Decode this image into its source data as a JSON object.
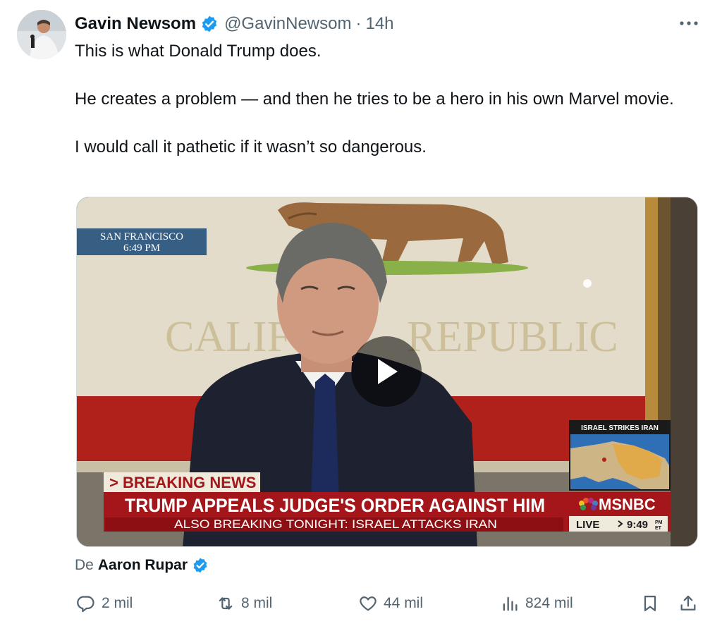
{
  "author": {
    "name": "Gavin Newsom",
    "handle": "@GavinNewsom",
    "separator": "·",
    "time": "14h"
  },
  "tweet": {
    "line1": "This is what Donald Trump does.",
    "line2": "He creates a problem — and then he tries to be a hero in his own Marvel movie.",
    "line3": "I would call it pathetic if it wasn’t so dangerous."
  },
  "video": {
    "location": "SAN FRANCISCO",
    "clock": "6:49 PM",
    "flag_text_left": "CALIFO",
    "flag_text_right": "REPUBLIC",
    "breaking_tag": "> BREAKING NEWS",
    "headline": "TRUMP APPEALS JUDGE'S ORDER AGAINST HIM",
    "subheadline": "ALSO BREAKING TONIGHT: ISRAEL ATTACKS IRAN",
    "inset_title": "ISRAEL STRIKES IRAN",
    "network": "MSNBC",
    "live": "LIVE",
    "live_time": "9:49",
    "live_zone_top": "PM",
    "live_zone_bottom": "ET",
    "colors": {
      "banner_red": "#a5161a",
      "flag_red": "#b0211c",
      "map_water": "#2f6fb5",
      "map_land": "#e0a94a"
    }
  },
  "source": {
    "prefix": "De",
    "author": "Aaron Rupar"
  },
  "actions": {
    "replies": "2 mil",
    "reposts": "8 mil",
    "likes": "44 mil",
    "views": "824 mil"
  },
  "colors": {
    "accent": "#1d9bf0",
    "text": "#0f1419",
    "muted": "#536471"
  }
}
